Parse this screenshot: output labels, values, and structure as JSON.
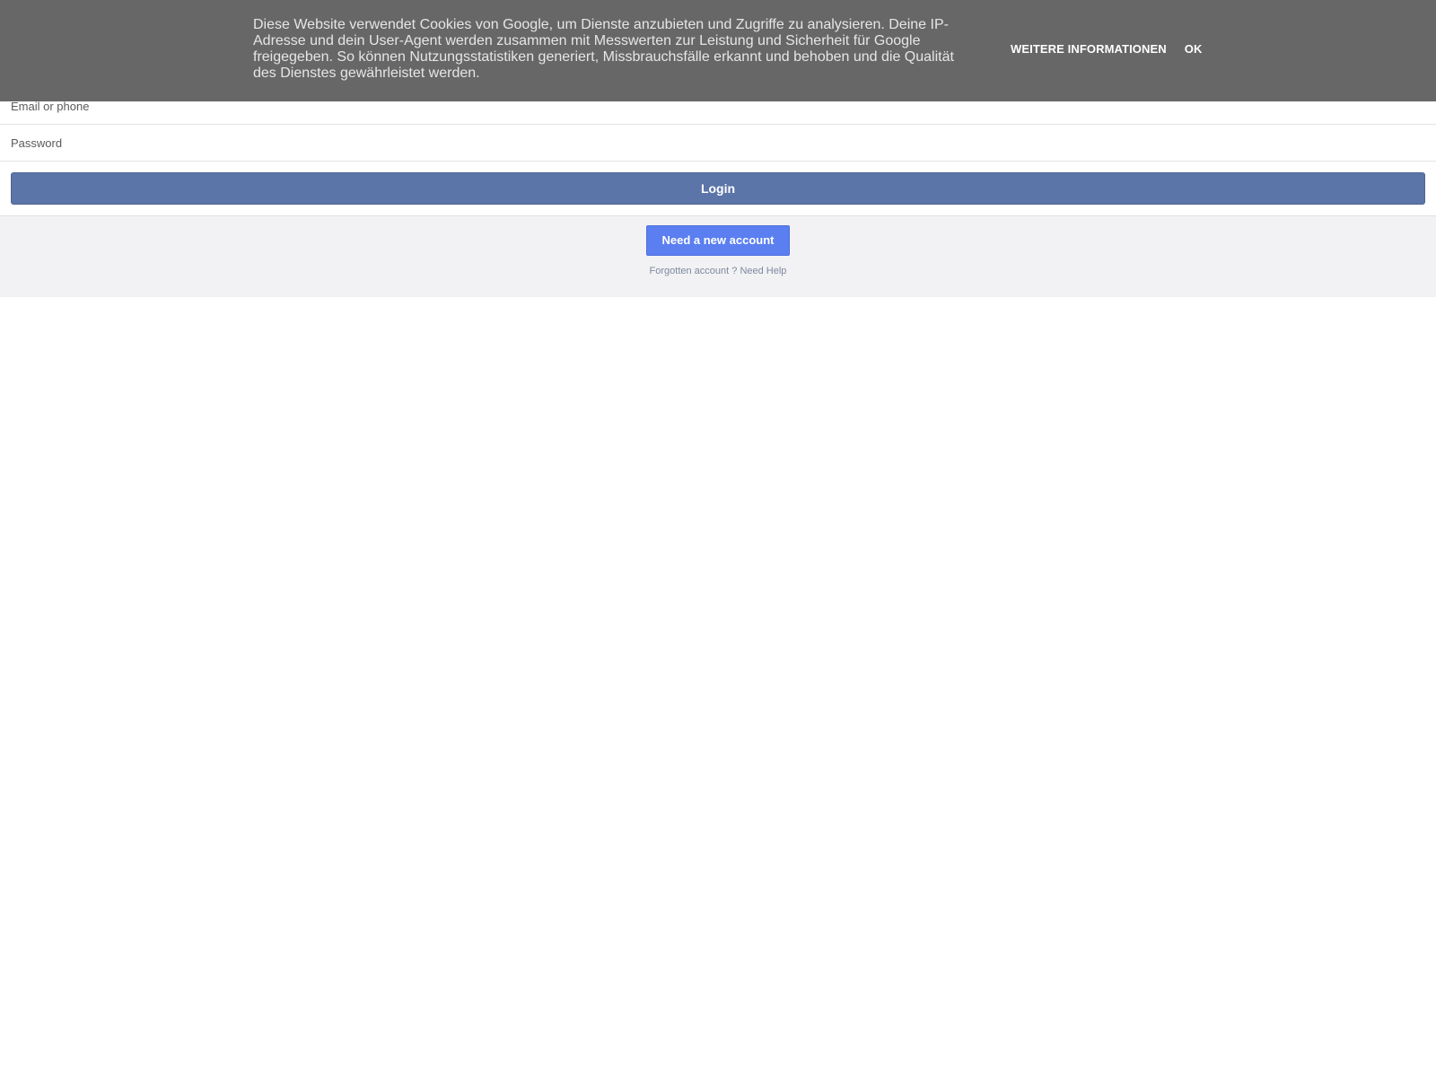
{
  "cookie_banner": {
    "text": "Diese Website verwendet Cookies von Google, um Dienste anzubieten und Zugriffe zu analysieren. Deine IP-Adresse und dein User-Agent werden zusammen mit Messwerten zur Leistung und Sicherheit für Google freigegeben. So können Nutzungsstatistiken generiert, Missbrauchsfälle erkannt und behoben und die Qualität des Dienstes gewährleistet werden.",
    "more_info_label": "WEITERE INFORMATIONEN",
    "ok_label": "OK"
  },
  "login_form": {
    "email_placeholder": "Email or phone",
    "email_value": "",
    "password_placeholder": "Password",
    "password_value": "",
    "login_label": "Login"
  },
  "secondary": {
    "new_account_label": "Need a new account",
    "forgotten_label": "Forgotten account ?",
    "need_help_label": "Need Help"
  },
  "colors": {
    "banner_bg": "#676767",
    "login_button": "#5b75a8",
    "new_account_button": "#5b7ff0",
    "secondary_bg": "#f2f2f4"
  }
}
